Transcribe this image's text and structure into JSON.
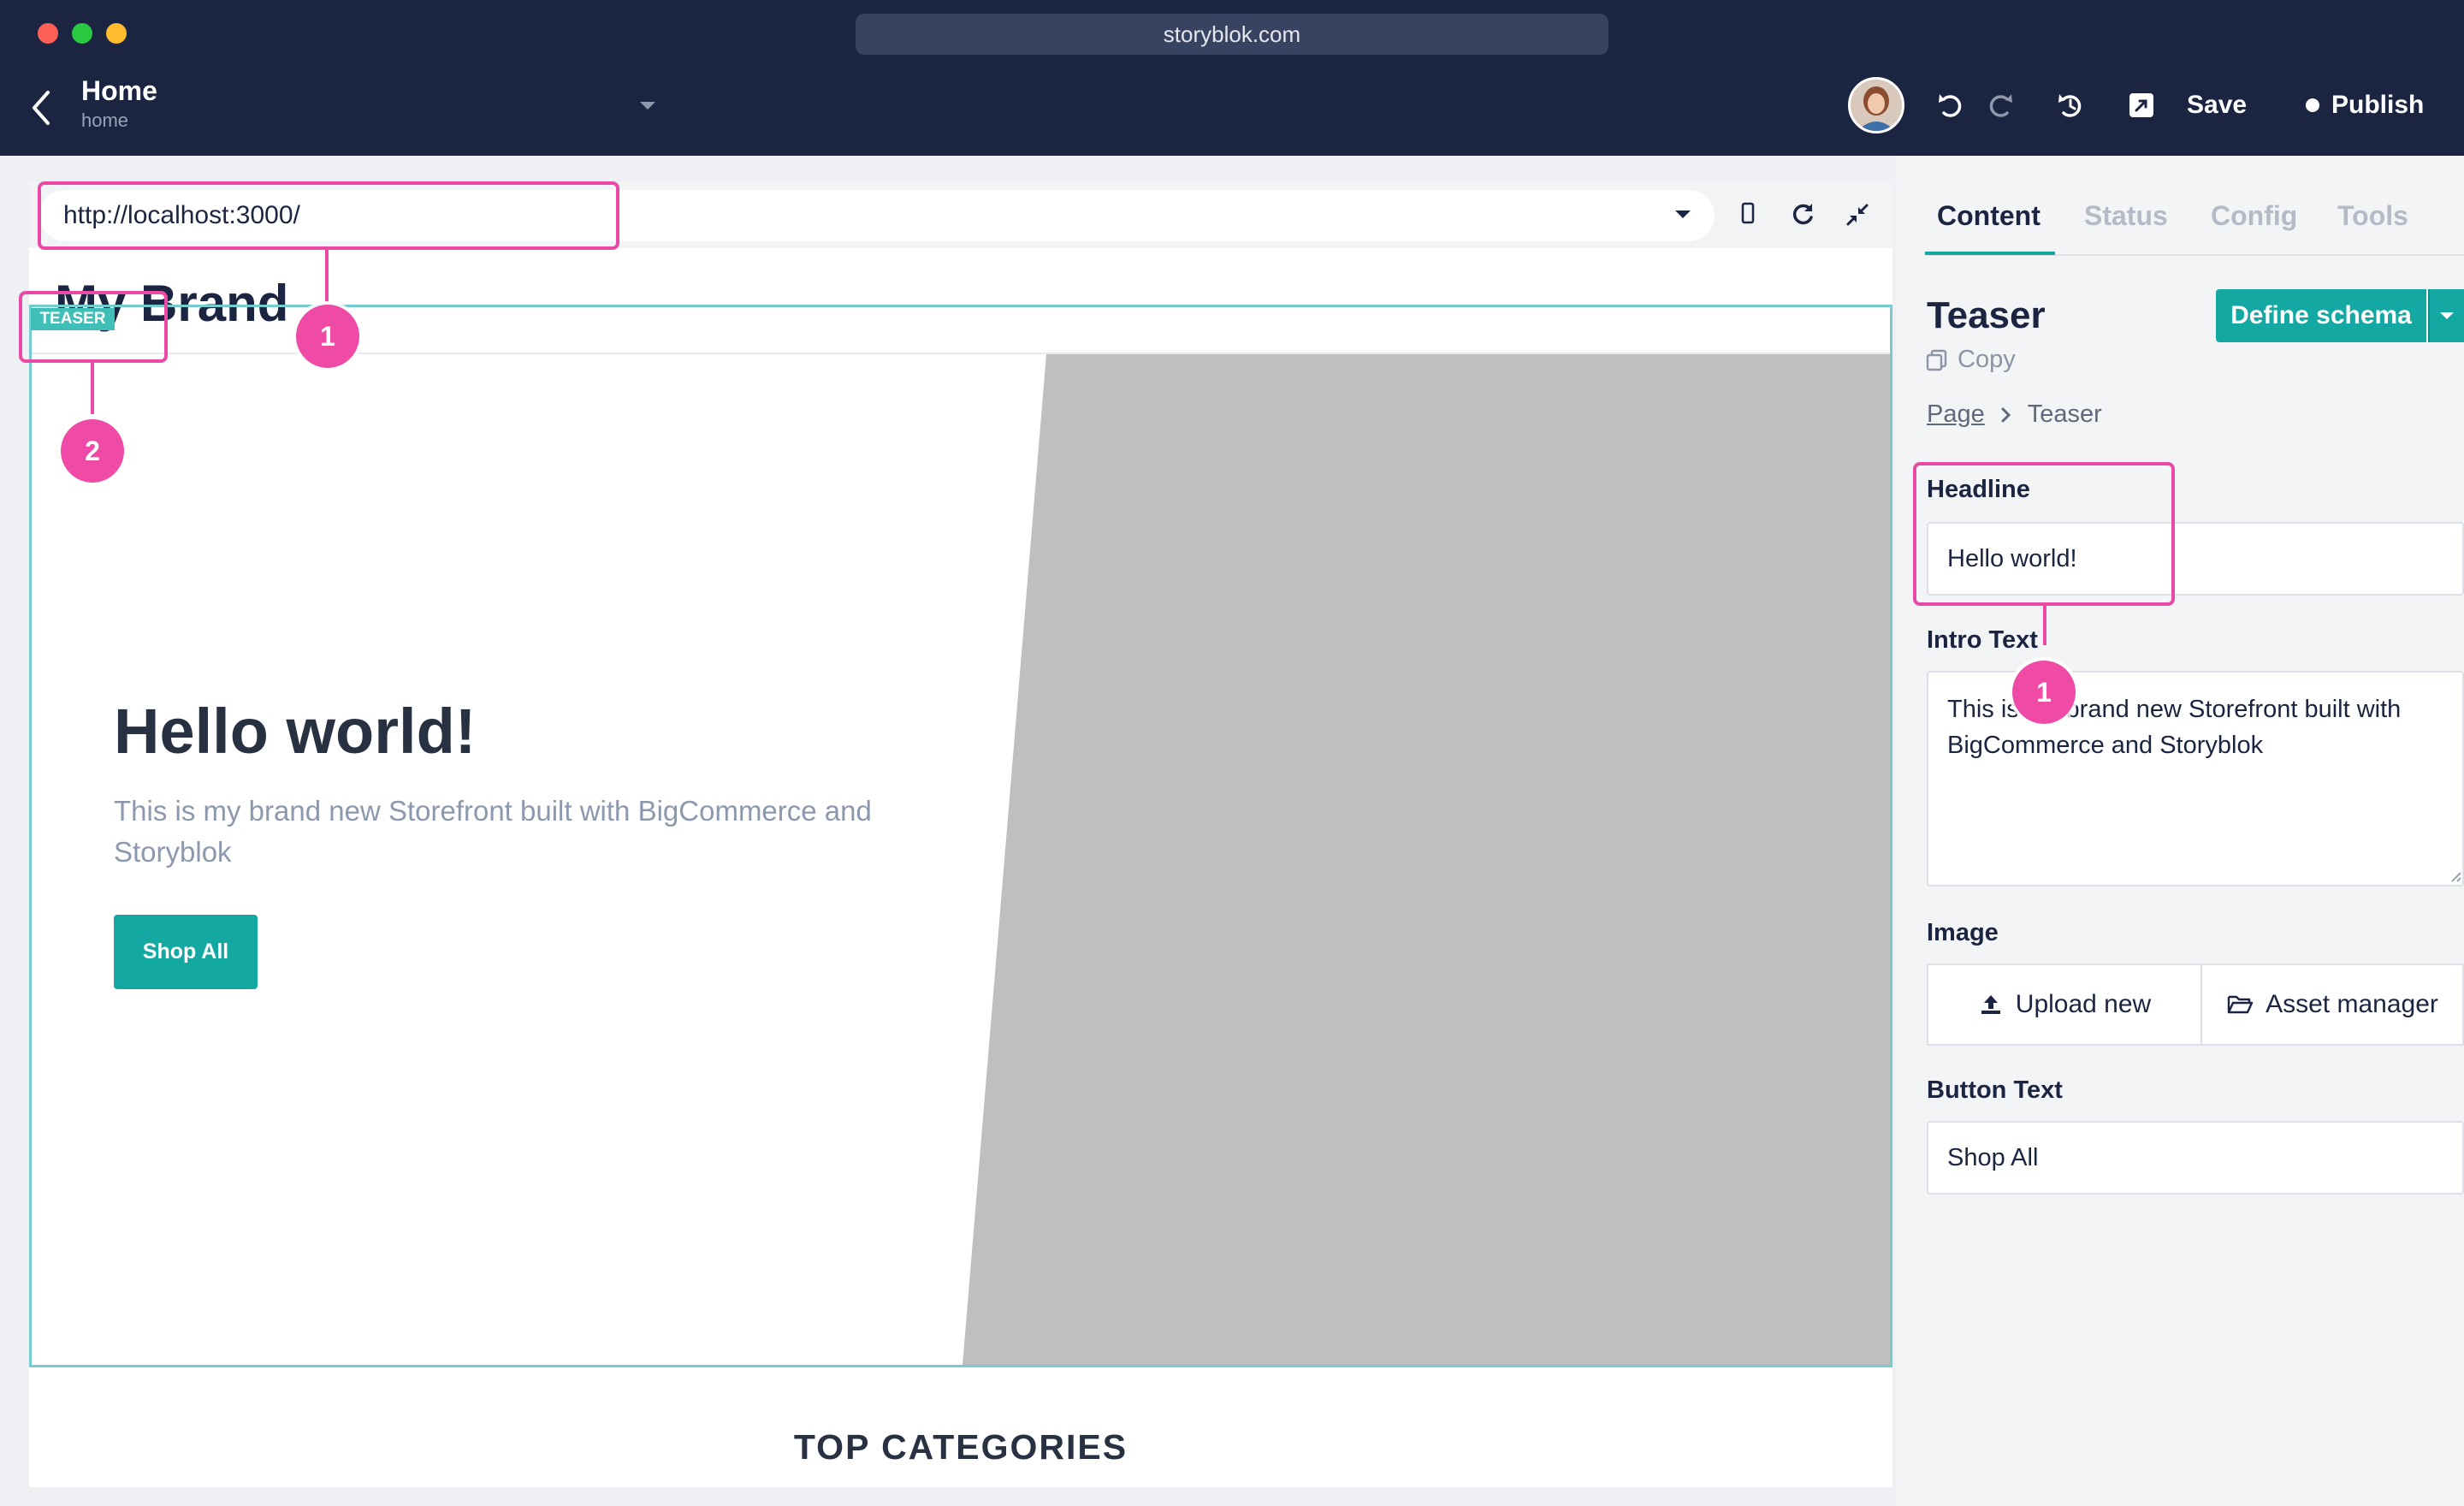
{
  "browser": {
    "url": "storyblok.com"
  },
  "header": {
    "title": "Home",
    "slug": "home",
    "save_label": "Save",
    "publish_label": "Publish"
  },
  "preview": {
    "address": "http://localhost:3000/",
    "brand": "My Brand",
    "badge": "TEASER",
    "hero_title": "Hello world!",
    "hero_intro": "This is my brand new Storefront built with BigCommerce and Storyblok",
    "hero_button": "Shop All",
    "section_title": "TOP CATEGORIES"
  },
  "annotations": {
    "url_marker": "1",
    "teaser_marker": "2",
    "headline_marker": "1"
  },
  "panel": {
    "tabs": [
      "Content",
      "Status",
      "Config",
      "Tools"
    ],
    "block_title": "Teaser",
    "copy_label": "Copy",
    "define_schema": "Define schema",
    "breadcrumb_page": "Page",
    "breadcrumb_current": "Teaser",
    "fields": {
      "headline_label": "Headline",
      "headline_value": "Hello world!",
      "intro_label": "Intro Text",
      "intro_value": "This is my brand new Storefront built with BigCommerce and Storyblok",
      "image_label": "Image",
      "upload_label": "Upload new",
      "asset_label": "Asset manager",
      "button_label": "Button Text",
      "button_value": "Shop All"
    }
  },
  "colors": {
    "header_bg": "#1b2440",
    "accent": "#13a8a2",
    "annotation": "#ea4aa5"
  }
}
